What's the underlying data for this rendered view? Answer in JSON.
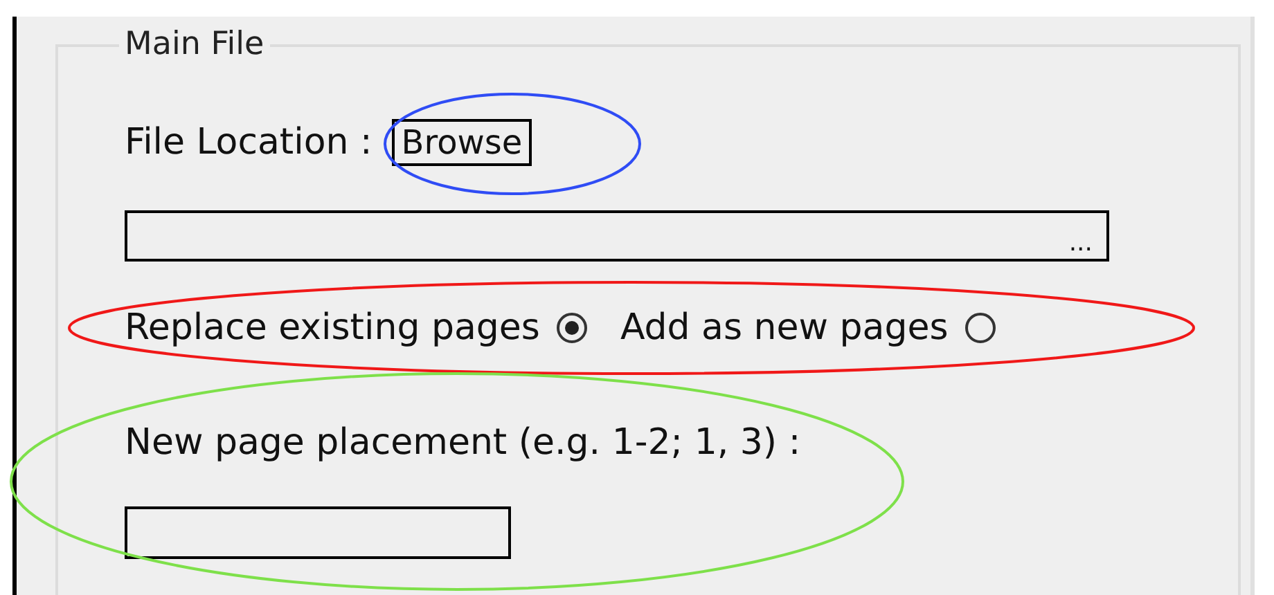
{
  "group": {
    "title": "Main File"
  },
  "file_location": {
    "label": "File Location :",
    "button": "Browse",
    "path_field": {
      "suffix": "..."
    }
  },
  "page_mode": [
    {
      "label": "Replace existing pages",
      "selected": true
    },
    {
      "label": "Add as new pages",
      "selected": false
    }
  ],
  "placement": {
    "label": "New page placement (e.g. 1-2; 1, 3) :"
  },
  "annotations": [
    {
      "color": "#2f4cf5"
    },
    {
      "color": "#f01818"
    },
    {
      "color": "#7ee04a"
    }
  ]
}
